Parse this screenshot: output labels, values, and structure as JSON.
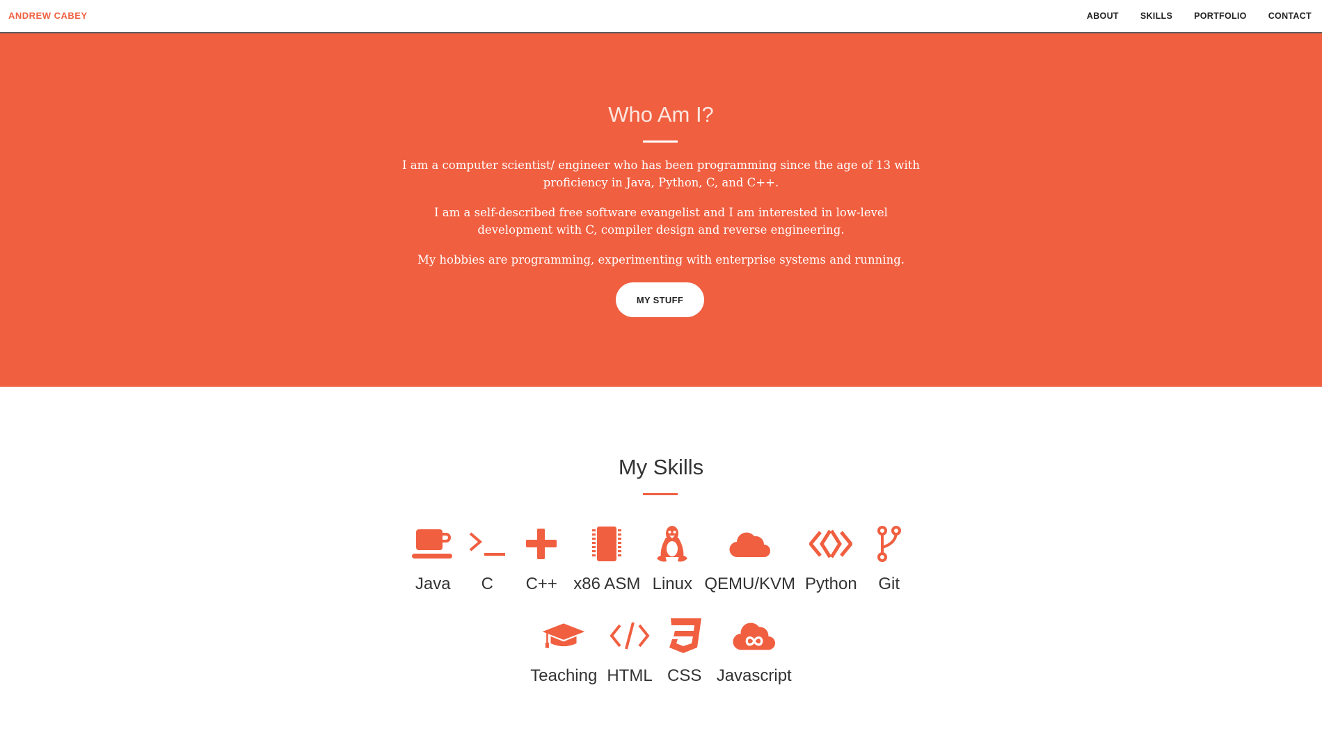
{
  "colors": {
    "accent": "#f05f40",
    "text": "#222222",
    "white": "#ffffff"
  },
  "nav": {
    "brand": "ANDREW CABEY",
    "items": [
      {
        "label": "ABOUT"
      },
      {
        "label": "SKILLS"
      },
      {
        "label": "PORTFOLIO"
      },
      {
        "label": "CONTACT"
      }
    ]
  },
  "about": {
    "heading": "Who Am I?",
    "paragraphs": [
      "I am a computer scientist/ engineer who has been programming since the age of 13 with proficiency in Java, Python, C, and C++.",
      "I am a self-described free software evangelist and I am interested in low-level development with C, compiler design and reverse engineering.",
      "My hobbies are programming, experimenting with enterprise systems and running."
    ],
    "button_label": "MY STUFF"
  },
  "skills": {
    "heading": "My Skills",
    "row1": [
      {
        "label": "Java",
        "icon": "coffee-cup-icon"
      },
      {
        "label": "C",
        "icon": "terminal-icon"
      },
      {
        "label": "C++",
        "icon": "plus-icon"
      },
      {
        "label": "x86 ASM",
        "icon": "chip-icon"
      },
      {
        "label": "Linux",
        "icon": "linux-penguin-icon"
      },
      {
        "label": "QEMU/KVM",
        "icon": "cloud-icon"
      },
      {
        "label": "Python",
        "icon": "code-diamond-icon"
      },
      {
        "label": "Git",
        "icon": "git-branch-icon"
      }
    ],
    "row2": [
      {
        "label": "Teaching",
        "icon": "graduation-cap-icon"
      },
      {
        "label": "HTML",
        "icon": "code-tags-icon"
      },
      {
        "label": "CSS",
        "icon": "css3-shield-icon"
      },
      {
        "label": "Javascript",
        "icon": "cloud-infinity-icon"
      }
    ]
  }
}
